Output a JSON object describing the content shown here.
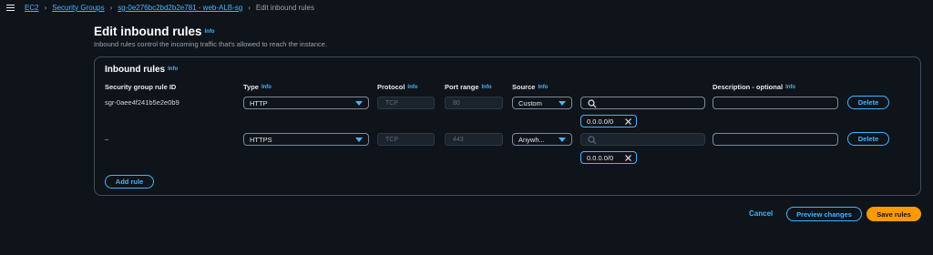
{
  "breadcrumb": {
    "items": [
      "EC2",
      "Security Groups",
      "sg-0e276bc2bd2b2e781 - web-ALB-sg"
    ],
    "current": "Edit inbound rules",
    "separator": "›"
  },
  "page": {
    "title": "Edit inbound rules",
    "info": "Info",
    "description": "Inbound rules control the incoming traffic that's allowed to reach the instance."
  },
  "panel": {
    "title": "Inbound rules",
    "info": "Info",
    "columns": {
      "rule_id": "Security group rule ID",
      "type": "Type",
      "protocol": "Protocol",
      "port_range": "Port range",
      "source": "Source",
      "description": "Description - optional"
    },
    "rows": [
      {
        "rule_id": "sgr-0aee4f241b5e2e0b9",
        "type": "HTTP",
        "protocol": "TCP",
        "port_range": "80",
        "source": "Custom",
        "cidr": "0.0.0.0/0",
        "delete": "Delete"
      },
      {
        "rule_id": "–",
        "type": "HTTPS",
        "protocol": "TCP",
        "port_range": "443",
        "source": "Anywh...",
        "cidr": "0.0.0.0/0",
        "delete": "Delete"
      }
    ],
    "add_rule": "Add rule"
  },
  "footer": {
    "cancel": "Cancel",
    "preview": "Preview changes",
    "save": "Save rules"
  },
  "colors": {
    "background": "#0f141a",
    "link": "#42b4ff",
    "primary": "#ff9900",
    "border": "#414d5c"
  }
}
